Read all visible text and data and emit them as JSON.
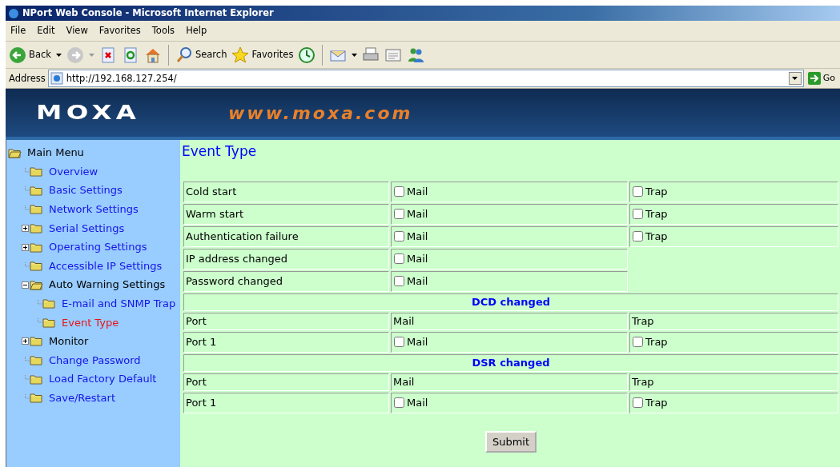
{
  "window": {
    "title": "NPort Web Console - Microsoft Internet Explorer"
  },
  "menu_bar": [
    "File",
    "Edit",
    "View",
    "Favorites",
    "Tools",
    "Help"
  ],
  "toolbar": [
    {
      "kind": "back",
      "label": "Back",
      "dropdown": true
    },
    {
      "kind": "forward",
      "dropdown": true
    },
    {
      "kind": "stop"
    },
    {
      "kind": "refresh"
    },
    {
      "kind": "home"
    },
    {
      "kind": "sep"
    },
    {
      "kind": "search",
      "label": "Search"
    },
    {
      "kind": "favorites",
      "label": "Favorites"
    },
    {
      "kind": "history"
    },
    {
      "kind": "sep"
    },
    {
      "kind": "mail",
      "dropdown": true
    },
    {
      "kind": "print"
    },
    {
      "kind": "edit"
    },
    {
      "kind": "messenger"
    }
  ],
  "address_bar": {
    "label": "Address",
    "value": "http://192.168.127.254/",
    "go_label": "Go"
  },
  "banner": {
    "logo": "MOXA",
    "url": "www.moxa.com"
  },
  "sidebar": {
    "label": "Main Menu",
    "expanded": true,
    "children": [
      {
        "label": "Overview",
        "kind": "link",
        "selected": false
      },
      {
        "label": "Basic Settings",
        "kind": "link",
        "selected": false
      },
      {
        "label": "Network Settings",
        "kind": "link",
        "selected": false
      },
      {
        "label": "Serial Settings",
        "kind": "link",
        "selected": false,
        "expanded": false
      },
      {
        "label": "Operating Settings",
        "kind": "link",
        "selected": false,
        "expanded": false
      },
      {
        "label": "Accessible IP Settings",
        "kind": "link",
        "selected": false
      },
      {
        "label": "Auto Warning Settings",
        "kind": "group",
        "selected": false,
        "expanded": true,
        "children": [
          {
            "label": "E-mail and SNMP Trap",
            "kind": "link",
            "selected": false
          },
          {
            "label": "Event Type",
            "kind": "link",
            "selected": true
          }
        ]
      },
      {
        "label": "Monitor",
        "kind": "group",
        "selected": false,
        "expanded": false
      },
      {
        "label": "Change Password",
        "kind": "link",
        "selected": false
      },
      {
        "label": "Load Factory Default",
        "kind": "link",
        "selected": false
      },
      {
        "label": "Save/Restart",
        "kind": "link",
        "selected": false
      }
    ]
  },
  "content": {
    "title": "Event Type",
    "events": [
      {
        "label": "Cold start",
        "mail": {
          "label": "Mail",
          "checked": false
        },
        "trap": {
          "label": "Trap",
          "checked": false
        }
      },
      {
        "label": "Warm start",
        "mail": {
          "label": "Mail",
          "checked": false
        },
        "trap": {
          "label": "Trap",
          "checked": false
        }
      },
      {
        "label": "Authentication failure",
        "mail": {
          "label": "Mail",
          "checked": false
        },
        "trap": {
          "label": "Trap",
          "checked": false
        }
      },
      {
        "label": "IP address changed",
        "mail": {
          "label": "Mail",
          "checked": false
        }
      },
      {
        "label": "Password changed",
        "mail": {
          "label": "Mail",
          "checked": false
        }
      }
    ],
    "sections": [
      {
        "title": "DCD changed",
        "columns": [
          "Port",
          "Mail",
          "Trap"
        ],
        "rows": [
          {
            "port": "Port 1",
            "mail": {
              "label": "Mail",
              "checked": false
            },
            "trap": {
              "label": "Trap",
              "checked": false
            }
          }
        ]
      },
      {
        "title": "DSR changed",
        "columns": [
          "Port",
          "Mail",
          "Trap"
        ],
        "rows": [
          {
            "port": "Port 1",
            "mail": {
              "label": "Mail",
              "checked": false
            },
            "trap": {
              "label": "Trap",
              "checked": false
            }
          }
        ]
      }
    ],
    "submit": "Submit"
  }
}
